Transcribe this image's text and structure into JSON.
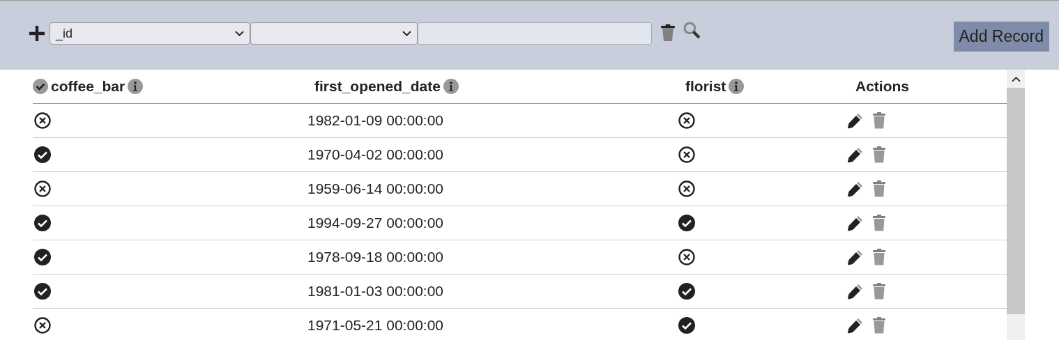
{
  "filter_bar": {
    "field_select": {
      "value": "_id"
    },
    "add_button": "Add Record"
  },
  "table": {
    "columns": [
      {
        "label": "coffee_bar",
        "kind": "bool",
        "checked": true,
        "info": true
      },
      {
        "label": "first_opened_date",
        "kind": "text",
        "info": true
      },
      {
        "label": "florist",
        "kind": "bool",
        "info": true
      },
      {
        "label": "Actions",
        "kind": "actions",
        "info": false
      }
    ],
    "rows": [
      {
        "coffee_bar": false,
        "first_opened_date": "1982-01-09 00:00:00",
        "florist": false
      },
      {
        "coffee_bar": true,
        "first_opened_date": "1970-04-02 00:00:00",
        "florist": false
      },
      {
        "coffee_bar": false,
        "first_opened_date": "1959-06-14 00:00:00",
        "florist": false
      },
      {
        "coffee_bar": true,
        "first_opened_date": "1994-09-27 00:00:00",
        "florist": true
      },
      {
        "coffee_bar": true,
        "first_opened_date": "1978-09-18 00:00:00",
        "florist": false
      },
      {
        "coffee_bar": true,
        "first_opened_date": "1981-01-03 00:00:00",
        "florist": true
      },
      {
        "coffee_bar": false,
        "first_opened_date": "1971-05-21 00:00:00",
        "florist": true
      }
    ]
  }
}
